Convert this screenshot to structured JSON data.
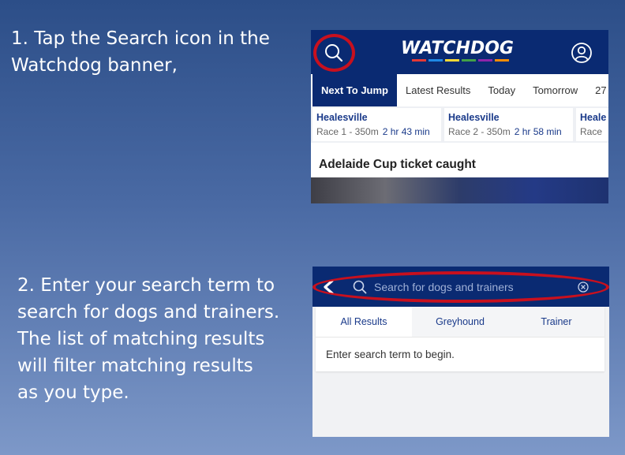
{
  "instructions": {
    "step1": "1. Tap the Search icon in the\nWatchdog banner,",
    "step2": "2. Enter your search term to\nsearch for dogs and trainers.\nThe list of matching results\nwill filter matching results\nas you type."
  },
  "screen1": {
    "logo_text": "WATCHDOG",
    "logo_stripe_colors": [
      "#e53935",
      "#1e88e5",
      "#fdd835",
      "#43a047",
      "#8e24aa",
      "#fb8c00"
    ],
    "tabs": [
      "Next To Jump",
      "Latest Results",
      "Today",
      "Tomorrow",
      "27"
    ],
    "races": [
      {
        "venue": "Healesville",
        "race": "Race 1 - 350m",
        "time": "2 hr 43 min"
      },
      {
        "venue": "Healesville",
        "race": "Race 2 - 350m",
        "time": "2 hr 58 min"
      },
      {
        "venue": "Heale",
        "race": "Race",
        "time": ""
      }
    ],
    "news_title": "Adelaide Cup ticket caught"
  },
  "screen2": {
    "search_placeholder": "Search for dogs and trainers",
    "tabs": [
      "All Results",
      "Greyhound",
      "Trainer"
    ],
    "empty_message": "Enter search term to begin."
  },
  "colors": {
    "banner": "#0a2a72",
    "highlight_ring": "#c8101e",
    "link_blue": "#1a3a8a"
  }
}
